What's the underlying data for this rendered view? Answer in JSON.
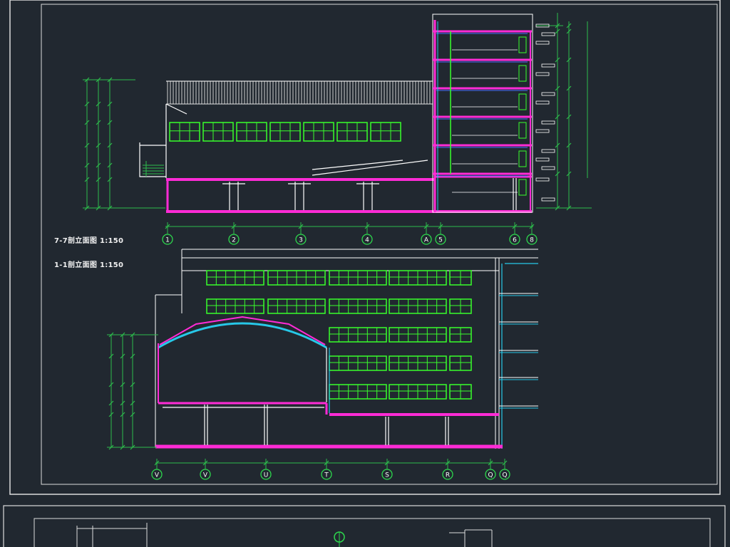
{
  "colors": {
    "background": "#212830",
    "frame": "#dcdcdc",
    "wall": "#ff2bd6",
    "window": "#39ff2b",
    "structure": "#ffffff",
    "dimension": "#2dbb4c",
    "axis_bubble": "#2dd84d",
    "cyan": "#27c8e8",
    "blue": "#4a6cff",
    "yellow": "#f0e030"
  },
  "titles": {
    "section_77": "7-7剖立面图 1:150",
    "section_11": "1-1剖立面图 1:150"
  },
  "axes_top": [
    "1",
    "2",
    "3",
    "4",
    "A",
    "5",
    "6",
    "8"
  ],
  "axes_bottom": [
    "V",
    "V",
    "U",
    "T",
    "S",
    "R",
    "Q",
    "Q"
  ],
  "icons": [
    "north-arrow-icon"
  ]
}
